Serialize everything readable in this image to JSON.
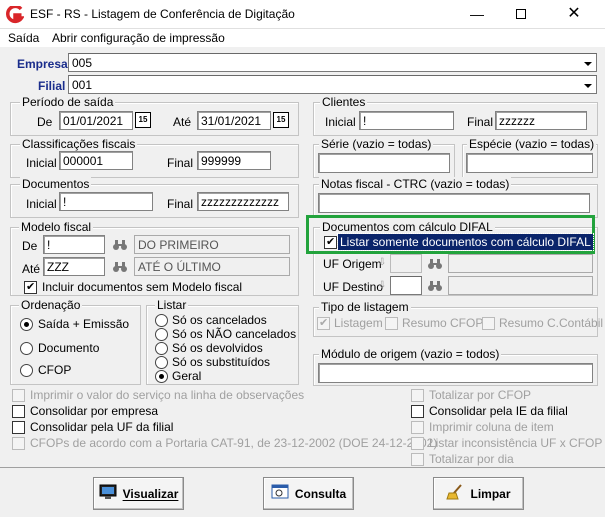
{
  "window": {
    "title": "ESF - RS - Listagem de Conferência de Digitação",
    "minimize": "—",
    "close": "✕"
  },
  "menu": [
    "Saída",
    "Abrir configuração de impressão"
  ],
  "empresa": {
    "label": "Empresa",
    "value": "005"
  },
  "filial": {
    "label": "Filial",
    "value": "001"
  },
  "periodo": {
    "title": "Período de saída",
    "de_label": "De",
    "de": "01/01/2021",
    "ate_label": "Até",
    "ate": "31/01/2021",
    "cal": "15"
  },
  "clientes": {
    "title": "Clientes",
    "inicial_label": "Inicial",
    "inicial": "!",
    "final_label": "Final",
    "final": "zzzzzz"
  },
  "classificacoes": {
    "title": "Classificações fiscais",
    "inicial_label": "Inicial",
    "inicial": "000001",
    "final_label": "Final",
    "final": "999999"
  },
  "serie": {
    "title": "Série (vazio = todas)",
    "value": ""
  },
  "especie": {
    "title": "Espécie (vazio = todas)",
    "value": ""
  },
  "documentos": {
    "title": "Documentos",
    "inicial_label": "Inicial",
    "inicial": "!",
    "final_label": "Final",
    "final": "zzzzzzzzzzzzz"
  },
  "notas": {
    "title": "Notas fiscal - CTRC (vazio = todas)",
    "value": ""
  },
  "modelo": {
    "title": "Modelo fiscal",
    "de_label": "De",
    "de": "!",
    "de_desc": "DO PRIMEIRO",
    "ate_label": "Até",
    "ate": "ZZZ",
    "ate_desc": "ATÉ O ÚLTIMO",
    "incluir": "Incluir documentos sem Modelo fiscal"
  },
  "difal": {
    "title": "Documentos com cálculo DIFAL",
    "listar": "Listar somente documentos com cálculo DIFAL",
    "uf_origem": "UF Origem",
    "uf_destino": "UF Destino"
  },
  "ordenacao": {
    "title": "Ordenação",
    "options": [
      "Saída + Emissão",
      "Documento",
      "CFOP"
    ]
  },
  "listar": {
    "title": "Listar",
    "options": [
      "Só os cancelados",
      "Só os NÃO cancelados",
      "Só os devolvidos",
      "Só os substituídos",
      "Geral"
    ]
  },
  "tipo": {
    "title": "Tipo de listagem",
    "options": [
      "Listagem",
      "Resumo  CFOP",
      "Resumo C.Contábil"
    ]
  },
  "modulo": {
    "title": "Módulo de origem (vazio = todos)",
    "value": ""
  },
  "left_checks": [
    {
      "label": "Imprimir o valor do serviço na linha de observações",
      "enabled": false
    },
    {
      "label": "Consolidar por empresa",
      "enabled": true
    },
    {
      "label": "Consolidar pela UF da filial",
      "enabled": true
    },
    {
      "label": "CFOPs de acordo com a Portaria CAT-91, de 23-12-2002 (DOE 24-12-2002)",
      "enabled": false
    }
  ],
  "right_checks": [
    {
      "label": "Totalizar por CFOP",
      "enabled": false
    },
    {
      "label": "Consolidar pela IE da filial",
      "enabled": true
    },
    {
      "label": "Imprimir coluna de item",
      "enabled": false
    },
    {
      "label": "Listar inconsistência UF x CFOP",
      "enabled": false
    },
    {
      "label": "Totalizar por dia",
      "enabled": false
    }
  ],
  "buttons": {
    "visualizar": "Visualizar",
    "consulta": "Consulta",
    "limpar": "Limpar"
  },
  "colors": {
    "accent_green": "#22a33c",
    "label_blue": "#1a2d8c",
    "logo_red": "#d9262a"
  }
}
